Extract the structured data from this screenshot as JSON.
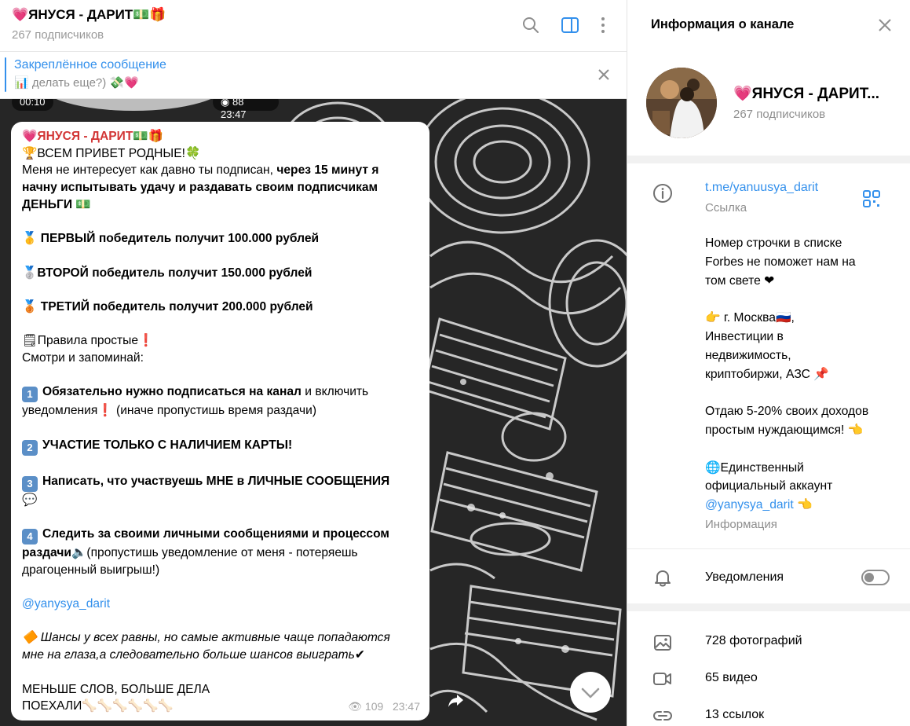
{
  "chat": {
    "title": "💗ЯНУСЯ - ДАРИТ💵🎁",
    "subscribers": "267 подписчиков",
    "pinned_label": "Закреплённое сообщение",
    "pinned_text": "📊 делать еще?) 💸💗",
    "prev_media_duration": "00:10",
    "prev_media_meta": "88  23:47",
    "icons": [
      "search-icon",
      "sidebar-toggle-icon",
      "more-vertical-icon",
      "close-icon"
    ]
  },
  "message": {
    "channel": "💗ЯНУСЯ - ДАРИТ💵🎁",
    "greeting": "🏆ВСЕМ ПРИВЕТ РОДНЫЕ!🍀",
    "intro_1": "Меня не интересует как давно ты подписан, ",
    "intro_1b": "через 15 минут я",
    "intro_2": "начну испытывать удачу и раздавать своим подписчикам",
    "intro_3": "ДЕНЬГИ 💵",
    "prize_1": "🥇 ПЕРВЫЙ победитель получит 100.000 рублей",
    "prize_2": "🥈ВТОРОЙ победитель получит 150.000 рублей",
    "prize_3": "🥉 ТРЕТИЙ победитель получит 200.000 рублей",
    "rules_1": "🗒Правила простые❗",
    "rules_2": "Смотри и запоминай:",
    "step1_num": "1",
    "step1_bold": "Обязательно нужно подписаться на канал",
    "step1_rest": " и включить",
    "step1_line2": "уведомления❗ (иначе пропустишь время раздачи)",
    "step2_num": "2",
    "step2_bold": "УЧАСТИЕ ТОЛЬКО С НАЛИЧИЕМ КАРТЫ!",
    "step3_num": "3",
    "step3_bold": "Написать, что участвуешь МНЕ в ЛИЧНЫЕ СООБЩЕНИЯ",
    "step3_line2": "💬",
    "step4_num": "4",
    "step4_bold": "Следить за своими личными сообщениями и процессом",
    "step4_bold2": "раздачи",
    "step4_rest": "🔈(пропустишь уведомление от меня - потеряешь",
    "step4_line3": "драгоценный выигрыш!)",
    "mention": "@yanysya_darit",
    "note_1": "🔶 Шансы у всех равны, но самые активные чаще попадаются",
    "note_2": "мне на глаза,а следовательно больше шансов выиграть✔",
    "closing_1": "МЕНЬШЕ СЛОВ, БОЛЬШЕ ДЕЛА",
    "closing_2": "ПОЕХАЛИ🦴🦴🦴🦴🦴🦴",
    "views": "109",
    "time": "23:47"
  },
  "info": {
    "title": "Информация о канале",
    "name": "💗ЯНУСЯ - ДАРИТ...",
    "subscribers": "267 подписчиков",
    "link": "t.me/yanuusya_darit",
    "link_label": "Ссылка",
    "desc": [
      "Номер строчки в списке",
      "Forbes не поможет нам на",
      "том свете ❤",
      "",
      "👉 г. Москва🇷🇺,",
      "Инвестиции в",
      "недвижимость,",
      "криптобиржи, АЗС 📌",
      "",
      "Отдаю 5-20% своих доходов",
      "простым нуждающимся! 👈",
      "",
      "🌐Единственный",
      "официальный аккаунт"
    ],
    "desc_mention": "@yanysya_darit",
    "desc_mention_suffix": " 👈",
    "desc_label": "Информация",
    "notifications": "Уведомления",
    "notifications_on": false,
    "photos": "728 фотографий",
    "videos": "65 видео",
    "links": "13 ссылок"
  },
  "colors": {
    "accent": "#3390ec",
    "channel_name": "#d23636",
    "muted": "#8e8e8e"
  }
}
